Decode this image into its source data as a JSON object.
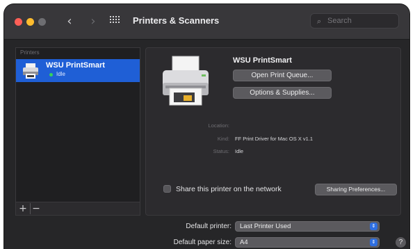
{
  "window": {
    "title": "Printers & Scanners",
    "search_placeholder": "Search"
  },
  "printers_list": {
    "header": "Printers",
    "items": [
      {
        "name": "WSU PrintSmart",
        "status": "Idle",
        "status_color": "#36d35a"
      }
    ],
    "add_label": "+",
    "remove_label": "−"
  },
  "detail": {
    "printer_name": "WSU PrintSmart",
    "open_queue_label": "Open Print Queue...",
    "options_label": "Options & Supplies...",
    "location_label": "Location:",
    "kind_label": "Kind:",
    "kind_value": "FF Print Driver for Mac OS X v1.1",
    "status_label": "Status:",
    "status_value": "Idle",
    "share_label": "Share this printer on the network",
    "share_checked": false,
    "sharing_prefs_label": "Sharing Preferences..."
  },
  "settings": {
    "default_printer_label": "Default printer:",
    "default_printer_value": "Last Printer Used",
    "default_paper_label": "Default paper size:",
    "default_paper_value": "A4"
  },
  "help_label": "?",
  "colors": {
    "selection": "#1f5fd6",
    "accent": "#2f6fe0",
    "close": "#ff5f57",
    "minimize": "#febc2e"
  },
  "icons": {
    "back": "chevron-left-icon",
    "forward": "chevron-right-icon",
    "grid": "grid-icon",
    "search": "search-icon",
    "printer": "printer-icon"
  }
}
